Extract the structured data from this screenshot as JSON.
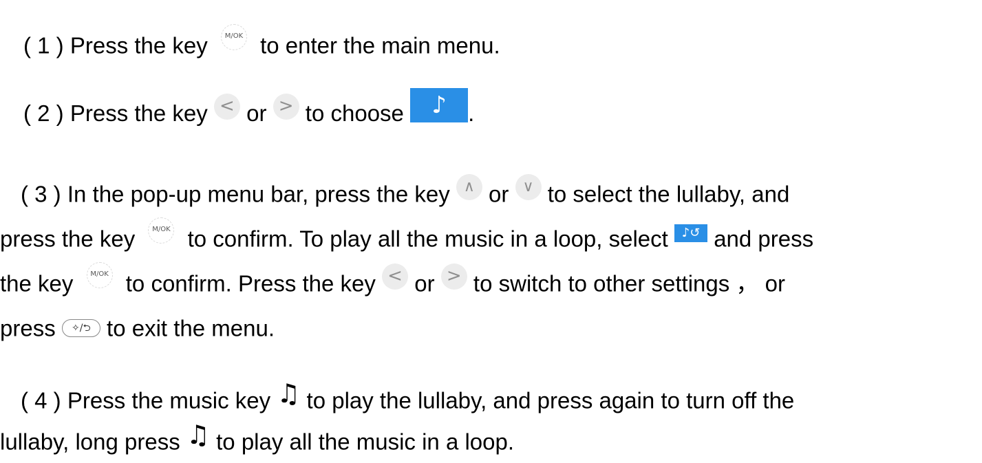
{
  "steps": [
    {
      "num": "( 1 )",
      "t1": "Press the key",
      "t2": "to enter the main menu."
    },
    {
      "num": "( 2 )",
      "t1": "Press the key",
      "t2": "or",
      "t3": "to choose",
      "t4": "."
    },
    {
      "num": "( 3 )",
      "l1a": "In the pop-up menu bar, press the key",
      "l1b": "or",
      "l1c": "to select the lullaby, and",
      "l2a": "press the key",
      "l2b": "to confirm. To play all the music in a loop, select",
      "l2c": "and press",
      "l3a": "the key",
      "l3b": "to confirm. Press the key",
      "l3c": "or",
      "l3d": "to switch to other settings ， or",
      "l4a": "press",
      "l4b": "to exit the menu."
    },
    {
      "num": "( 4 )",
      "l1a": "Press the music key",
      "l1b": "to play the lullaby, and press again to  turn off the",
      "l2a": "lullaby, long press",
      "l2b": "to play all the music in a loop."
    }
  ],
  "icons": {
    "mok_key": {
      "name": "mok-key-icon",
      "label": "M/OK"
    },
    "left_key": {
      "name": "left-arrow-key-icon",
      "glyph": "<"
    },
    "right_key": {
      "name": "right-arrow-key-icon",
      "glyph": ">"
    },
    "up_key": {
      "name": "up-arrow-key-icon",
      "glyph": "∧"
    },
    "down_key": {
      "name": "down-arrow-key-icon",
      "glyph": "∨"
    },
    "music_tile": {
      "name": "music-mode-icon",
      "glyph": "♪",
      "color": "#2a8fe6"
    },
    "loop_tile": {
      "name": "music-loop-icon",
      "glyph": "♪↺",
      "color": "#2a8fe6"
    },
    "back_key": {
      "name": "back-exit-key-icon",
      "glyph": "✧/⮌"
    },
    "note": {
      "name": "music-key-icon",
      "glyph": "♫"
    }
  }
}
